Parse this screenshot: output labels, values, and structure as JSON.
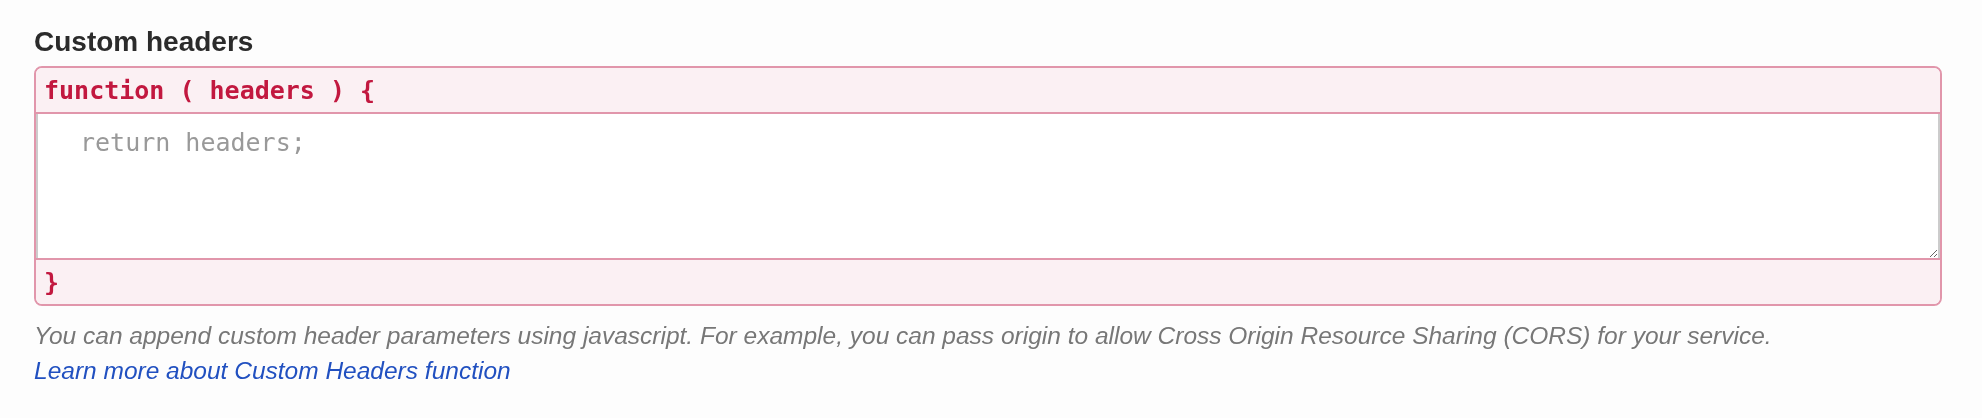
{
  "section": {
    "title": "Custom headers"
  },
  "editor": {
    "opening_line": "function ( headers ) {",
    "placeholder": "return headers;",
    "closing_line": "}"
  },
  "help": {
    "text": "You can append custom header parameters using javascript. For example, you can pass origin to allow Cross Origin Resource Sharing (CORS) for your service.",
    "link": "Learn more about Custom Headers function"
  }
}
